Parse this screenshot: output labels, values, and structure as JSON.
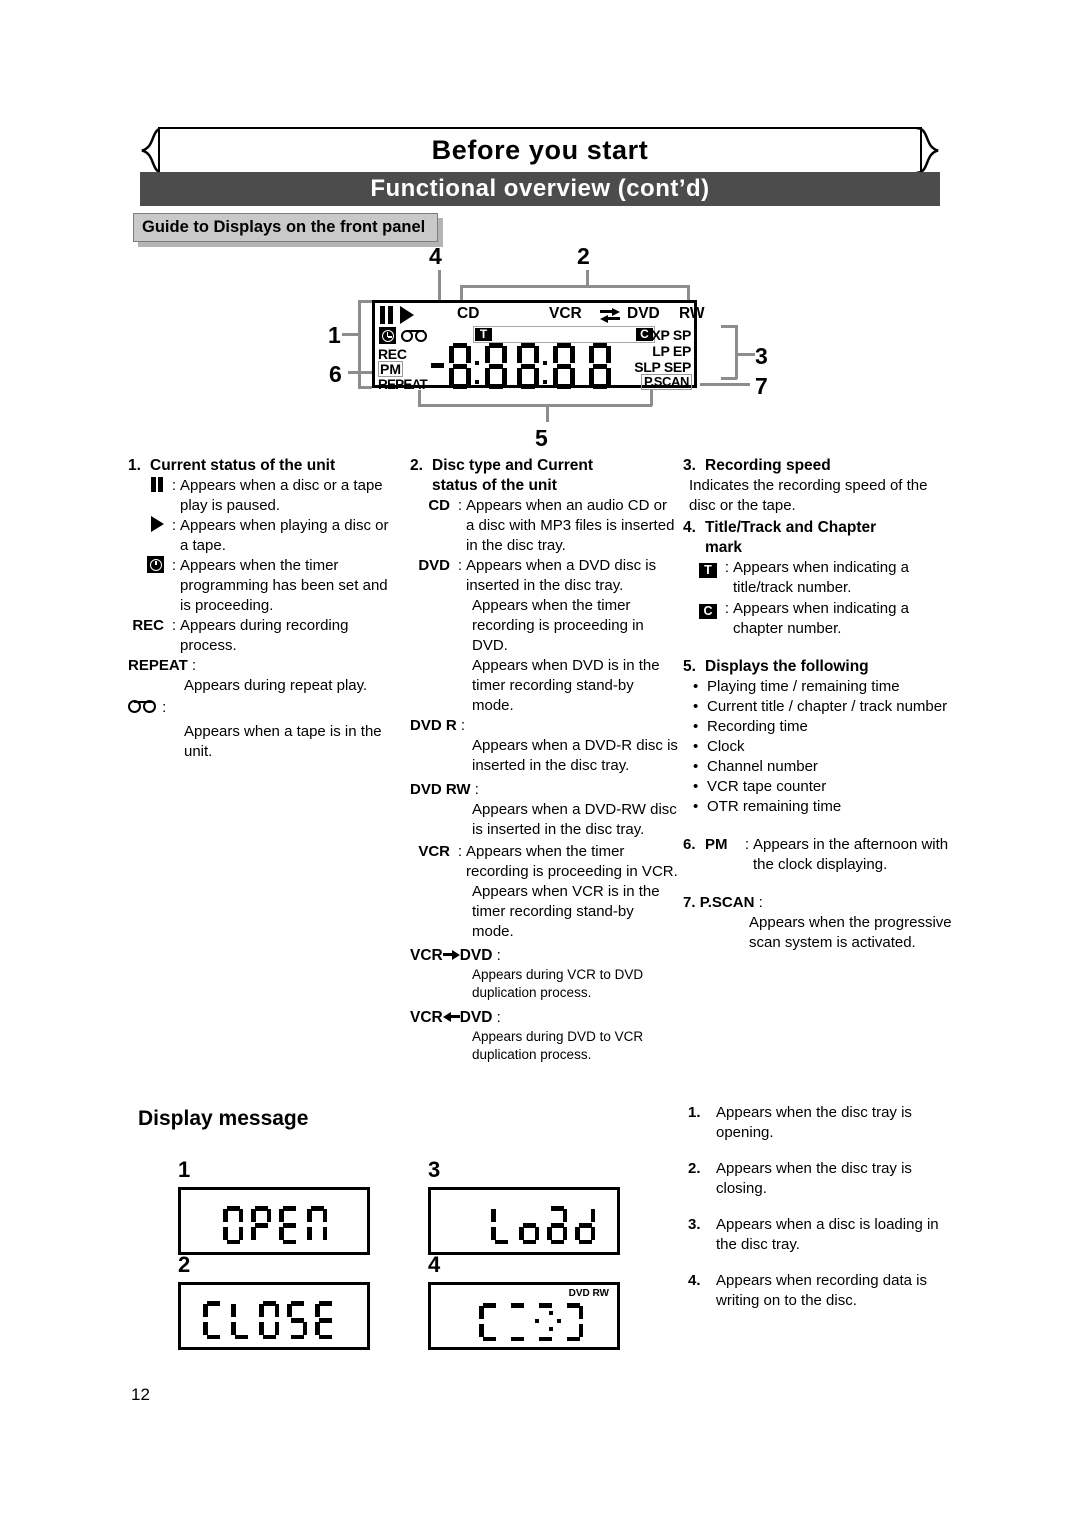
{
  "header": {
    "banner_title": "Before you start",
    "sub_bar_title": "Functional overview (cont’d)",
    "section_tag": "Guide to Displays on the front panel"
  },
  "lcd_panel": {
    "callouts": [
      "1",
      "2",
      "3",
      "4",
      "5",
      "6",
      "7"
    ],
    "status_labels": [
      "REC",
      "PM",
      "REPEAT"
    ],
    "disc_type_labels": [
      "CD",
      "VCR",
      "DVD",
      "RW"
    ],
    "speed_labels": [
      "XP SP",
      "LP EP",
      "SLP SEP"
    ],
    "pscan_label": "P.SCAN",
    "title_mark": "T",
    "chapter_mark": "C",
    "icons": [
      "pause-icon",
      "play-icon",
      "timer-icon",
      "tape-icon",
      "duplication-arrows-icon"
    ]
  },
  "columns": {
    "col1": {
      "heading_num": "1.",
      "heading": "Current status of the unit",
      "entries": [
        {
          "key": "pause-icon",
          "key_type": "icon",
          "sep": ":",
          "text": "Appears when a disc or a tape play is paused."
        },
        {
          "key": "play-icon",
          "key_type": "icon",
          "sep": ":",
          "text": "Appears when playing a disc or a tape."
        },
        {
          "key": "timer-icon",
          "key_type": "icon",
          "sep": ":",
          "text": "Appears when the timer programming has been set and is proceeding."
        },
        {
          "key": "REC",
          "key_type": "text",
          "sep": ":",
          "text": "Appears during recording process."
        },
        {
          "key": "REPEAT",
          "key_type": "text",
          "sep": ":",
          "text": "Appears during repeat play."
        },
        {
          "key": "tape-icon",
          "key_type": "icon",
          "sep": ":",
          "text": "Appears when a tape is in the unit."
        }
      ]
    },
    "col2": {
      "heading_num": "2.",
      "heading_line1": "Disc type and Current",
      "heading_line2": "status of the unit",
      "entries": [
        {
          "key": "CD",
          "sep": ":",
          "text": "Appears when an audio CD or a disc with MP3 files is inserted in the disc tray."
        },
        {
          "key": "DVD",
          "sep": ":",
          "text": "Appears when a DVD disc is inserted in the disc tray."
        },
        {
          "key": "",
          "sep": "",
          "text": "Appears when the timer recording is proceeding in DVD."
        },
        {
          "key": "",
          "sep": "",
          "text": "Appears when DVD is in the timer recording stand-by mode."
        },
        {
          "key": "DVD  R",
          "sep": ":",
          "text": "Appears when a DVD-R disc is inserted in the disc tray."
        },
        {
          "key": "DVD  RW",
          "sep": ":",
          "text": "Appears when a DVD-RW disc is inserted in the disc tray."
        },
        {
          "key": "VCR",
          "sep": ":",
          "text": "Appears when the timer recording is proceeding in VCR."
        },
        {
          "key": "",
          "sep": "",
          "text": "Appears when VCR is in the timer recording stand-by mode."
        },
        {
          "key": "VCR→DVD",
          "sep": ":",
          "text": "Appears during VCR to DVD duplication process."
        },
        {
          "key": "VCR←DVD",
          "sep": ":",
          "text": "Appears during DVD to VCR duplication process."
        }
      ]
    },
    "col3": {
      "s3_num": "3.",
      "s3_heading": "Recording speed",
      "s3_text": "Indicates the recording speed of the disc or the tape.",
      "s4_num": "4.",
      "s4_heading_line1": "Title/Track and Chapter",
      "s4_heading_line2": "mark",
      "s4_entries": [
        {
          "key": "T",
          "sep": ":",
          "text": "Appears when indicating a title/track number."
        },
        {
          "key": "C",
          "sep": ":",
          "text": "Appears when indicating a chapter number."
        }
      ],
      "s5_num": "5.",
      "s5_heading": "Displays the following",
      "s5_bullets": [
        "Playing time / remaining time",
        "Current title / chapter / track number",
        "Recording time",
        "Clock",
        "Channel number",
        "VCR tape counter",
        "OTR remaining time"
      ],
      "s6_num": "6.",
      "s6_key": "PM",
      "s6_sep": ":",
      "s6_text": "Appears in the afternoon with the clock displaying.",
      "s7_num": "7.",
      "s7_key": "P.SCAN",
      "s7_sep": ":",
      "s7_text": "Appears when the progressive scan system is activated."
    }
  },
  "display_message": {
    "title": "Display message",
    "panels": [
      {
        "num": "1",
        "text": "OPEN",
        "tag": ""
      },
      {
        "num": "2",
        "text": "CLOSE",
        "tag": ""
      },
      {
        "num": "3",
        "text": "Load",
        "tag": ""
      },
      {
        "num": "4",
        "text": "[::]",
        "tag": "DVD   RW"
      }
    ],
    "notes": [
      {
        "num": "1.",
        "text": "Appears when the disc tray is opening."
      },
      {
        "num": "2.",
        "text": "Appears when the disc tray is closing."
      },
      {
        "num": "3.",
        "text": "Appears when a disc is loading in the disc tray."
      },
      {
        "num": "4.",
        "text": "Appears when recording data is writing on to the disc."
      }
    ]
  },
  "footer": {
    "page_number": "12"
  }
}
